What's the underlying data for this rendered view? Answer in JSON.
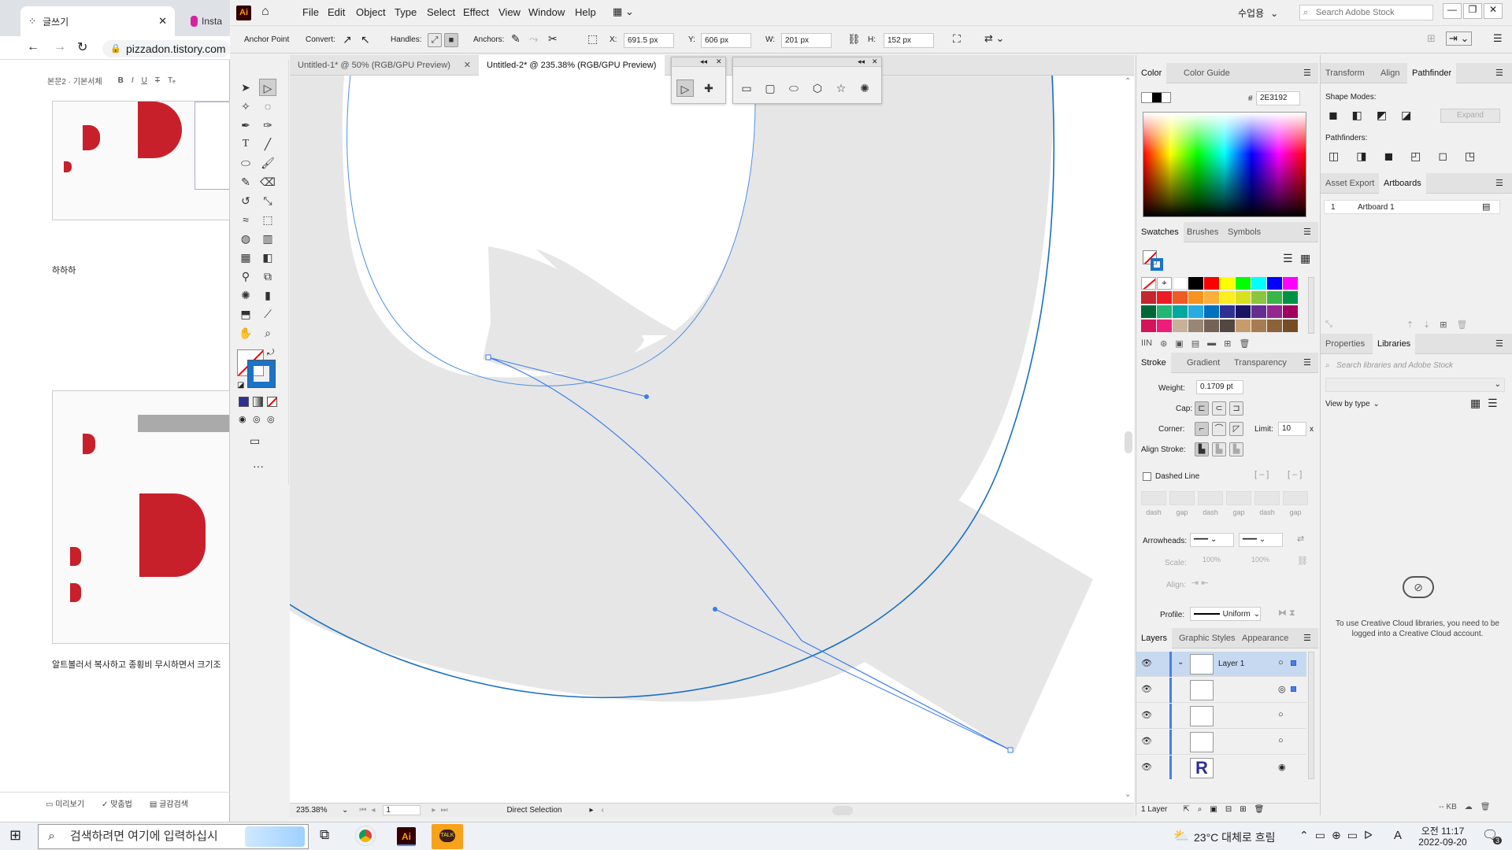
{
  "browser": {
    "tab1_title": "글쓰기",
    "tab2_title": "Insta",
    "url": "pizzadon.tistory.com",
    "toolbar_text": "본문2 · 기본서체",
    "text_haha": "하하하",
    "text_caption": "알트볼러서 복사하고 종횡비 무시하면서 크기조",
    "bottom_preview": "미리보기",
    "bottom_spell": "맞춤법",
    "bottom_tag": "글감검색"
  },
  "app": {
    "logo": "Ai",
    "menu": [
      "File",
      "Edit",
      "Object",
      "Type",
      "Select",
      "Effect",
      "View",
      "Window",
      "Help"
    ],
    "workspace": "수업용",
    "search_placeholder": "Search Adobe Stock",
    "window_minimize": "—",
    "window_restore": "❐",
    "window_close": "✕"
  },
  "control": {
    "tool_name": "Anchor Point",
    "convert_label": "Convert:",
    "handles_label": "Handles:",
    "anchors_label": "Anchors:",
    "x_label": "X:",
    "x_value": "691.5 px",
    "y_label": "Y:",
    "y_value": "606 px",
    "w_label": "W:",
    "w_value": "201 px",
    "h_label": "H:",
    "h_value": "152 px"
  },
  "documents": {
    "tabs": [
      {
        "label": "Untitled-1* @ 50% (RGB/GPU Preview)",
        "active": false
      },
      {
        "label": "Untitled-2* @ 235.38% (RGB/GPU Preview)",
        "active": true
      }
    ]
  },
  "status": {
    "zoom": "235.38%",
    "page": "1",
    "tool": "Direct Selection"
  },
  "color_panel": {
    "tabs": [
      "Color",
      "Color Guide"
    ],
    "hex_label": "#",
    "hex": "2E3192"
  },
  "swatches_panel": {
    "tabs": [
      "Swatches",
      "Brushes",
      "Symbols"
    ],
    "colors": [
      "#000000",
      "#ff0000",
      "#ffff00",
      "#00ff00",
      "#00ffff",
      "#0000ff",
      "#ff00ff",
      "#c1272d",
      "#ed1c24",
      "#f15a24",
      "#f7931e",
      "#fbb03b",
      "#fcee21",
      "#d9e021",
      "#8cc63f",
      "#39b54a",
      "#009245",
      "#006837",
      "#22b573",
      "#00a99d",
      "#29abe2",
      "#0071bc",
      "#2e3192",
      "#1b1464",
      "#662d91",
      "#93278f",
      "#9e005d",
      "#d4145a",
      "#ed1e79",
      "#c7b299",
      "#998675",
      "#736357",
      "#534741",
      "#c69c6d",
      "#a67c52",
      "#8c6239",
      "#754c24"
    ]
  },
  "stroke_panel": {
    "tabs": [
      "Stroke",
      "Gradient",
      "Transparency"
    ],
    "weight_label": "Weight:",
    "weight_value": "0.1709 pt",
    "cap_label": "Cap:",
    "corner_label": "Corner:",
    "limit_label": "Limit:",
    "limit_value": "10",
    "limit_x": "x",
    "align_label": "Align Stroke:",
    "dashed_label": "Dashed Line",
    "dash_labels": [
      "dash",
      "gap",
      "dash",
      "gap",
      "dash",
      "gap"
    ],
    "arrowheads_label": "Arrowheads:",
    "scale_label": "Scale:",
    "scale_value1": "100%",
    "scale_value2": "100%",
    "align2_label": "Align:",
    "profile_label": "Profile:",
    "profile_value": "Uniform"
  },
  "layers_panel": {
    "tabs": [
      "Layers",
      "Graphic Styles",
      "Appearance"
    ],
    "layer_name": "Layer 1",
    "footer": "1 Layer"
  },
  "right_panel": {
    "tabs_top": [
      "Transform",
      "Align",
      "Pathfinder"
    ],
    "shape_modes_label": "Shape Modes:",
    "expand_label": "Expand",
    "pathfinders_label": "Pathfinders:",
    "tabs_mid": [
      "Asset Export",
      "Artboards"
    ],
    "artboard_index": "1",
    "artboard_name": "Artboard 1",
    "tabs_bottom": [
      "Properties",
      "Libraries"
    ],
    "libraries_search_placeholder": "Search libraries and Adobe Stock",
    "view_by": "View by type",
    "cc_message": "To use Creative Cloud libraries, you need to be logged into a Creative Cloud account.",
    "footer_kb": "-- KB"
  },
  "taskbar": {
    "search_placeholder": "검색하려면 여기에 입력하십시",
    "weather": "23°C 대체로 흐림",
    "time": "오전 11:17",
    "date": "2022-09-20",
    "notif_count": "3",
    "lang": "A"
  }
}
